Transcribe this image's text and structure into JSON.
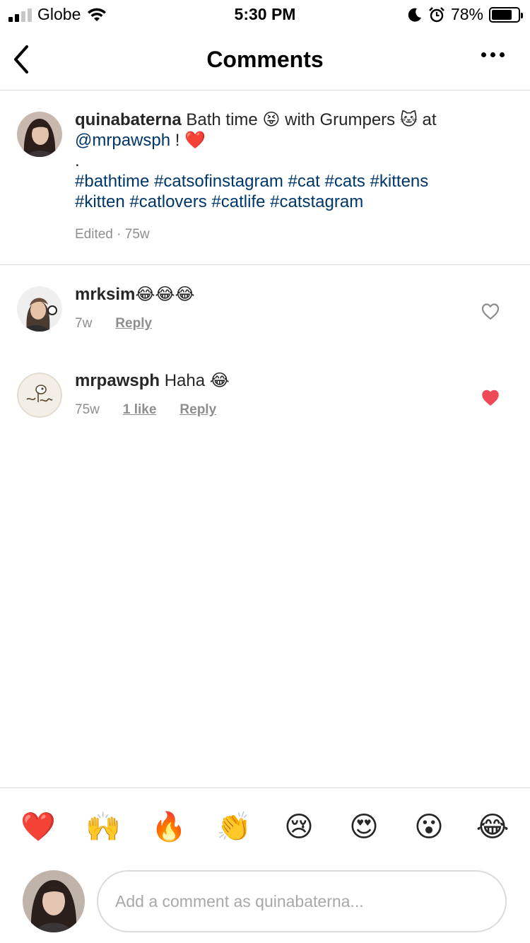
{
  "status_bar": {
    "carrier": "Globe",
    "time": "5:30 PM",
    "battery_pct": "78%",
    "battery_level": 0.78,
    "signal_bars": 2
  },
  "header": {
    "title": "Comments",
    "back_icon": "chevron-left-icon",
    "more_icon": "more-horizontal-icon"
  },
  "caption": {
    "username": "quinabaterna",
    "text_1": " Bath time ",
    "emoji_1": "😝",
    "text_2": " with Grumpers ",
    "emoji_2": "🐱",
    "text_3": " at",
    "mention": "@mrpawsph",
    "text_4": " ! ",
    "emoji_3": "❤️",
    "dot": ".",
    "hashtags_line1": "#bathtime #catsofinstagram #cat #cats #kittens",
    "hashtags_line2": "#kitten #catlovers #catlife #catstagram",
    "meta": "Edited · 75w"
  },
  "comments": [
    {
      "username": "mrksim",
      "text": "",
      "emoji": "😂😂😂",
      "time": "7w",
      "reply_label": "Reply",
      "liked": false
    },
    {
      "username": "mrpawsph",
      "text": " Haha ",
      "emoji": "😂",
      "time": "75w",
      "likes_label": "1 like",
      "reply_label": "Reply",
      "liked": true
    }
  ],
  "quick_reactions": [
    "❤️",
    "🙌",
    "🔥",
    "👏",
    "😢",
    "😍",
    "😮",
    "😂"
  ],
  "composer": {
    "placeholder": "Add a comment as quinabaterna..."
  },
  "colors": {
    "link": "#00376b",
    "liked_heart": "#ed4956",
    "meta_gray": "#8e8e8e",
    "divider": "#dbdbdb"
  }
}
